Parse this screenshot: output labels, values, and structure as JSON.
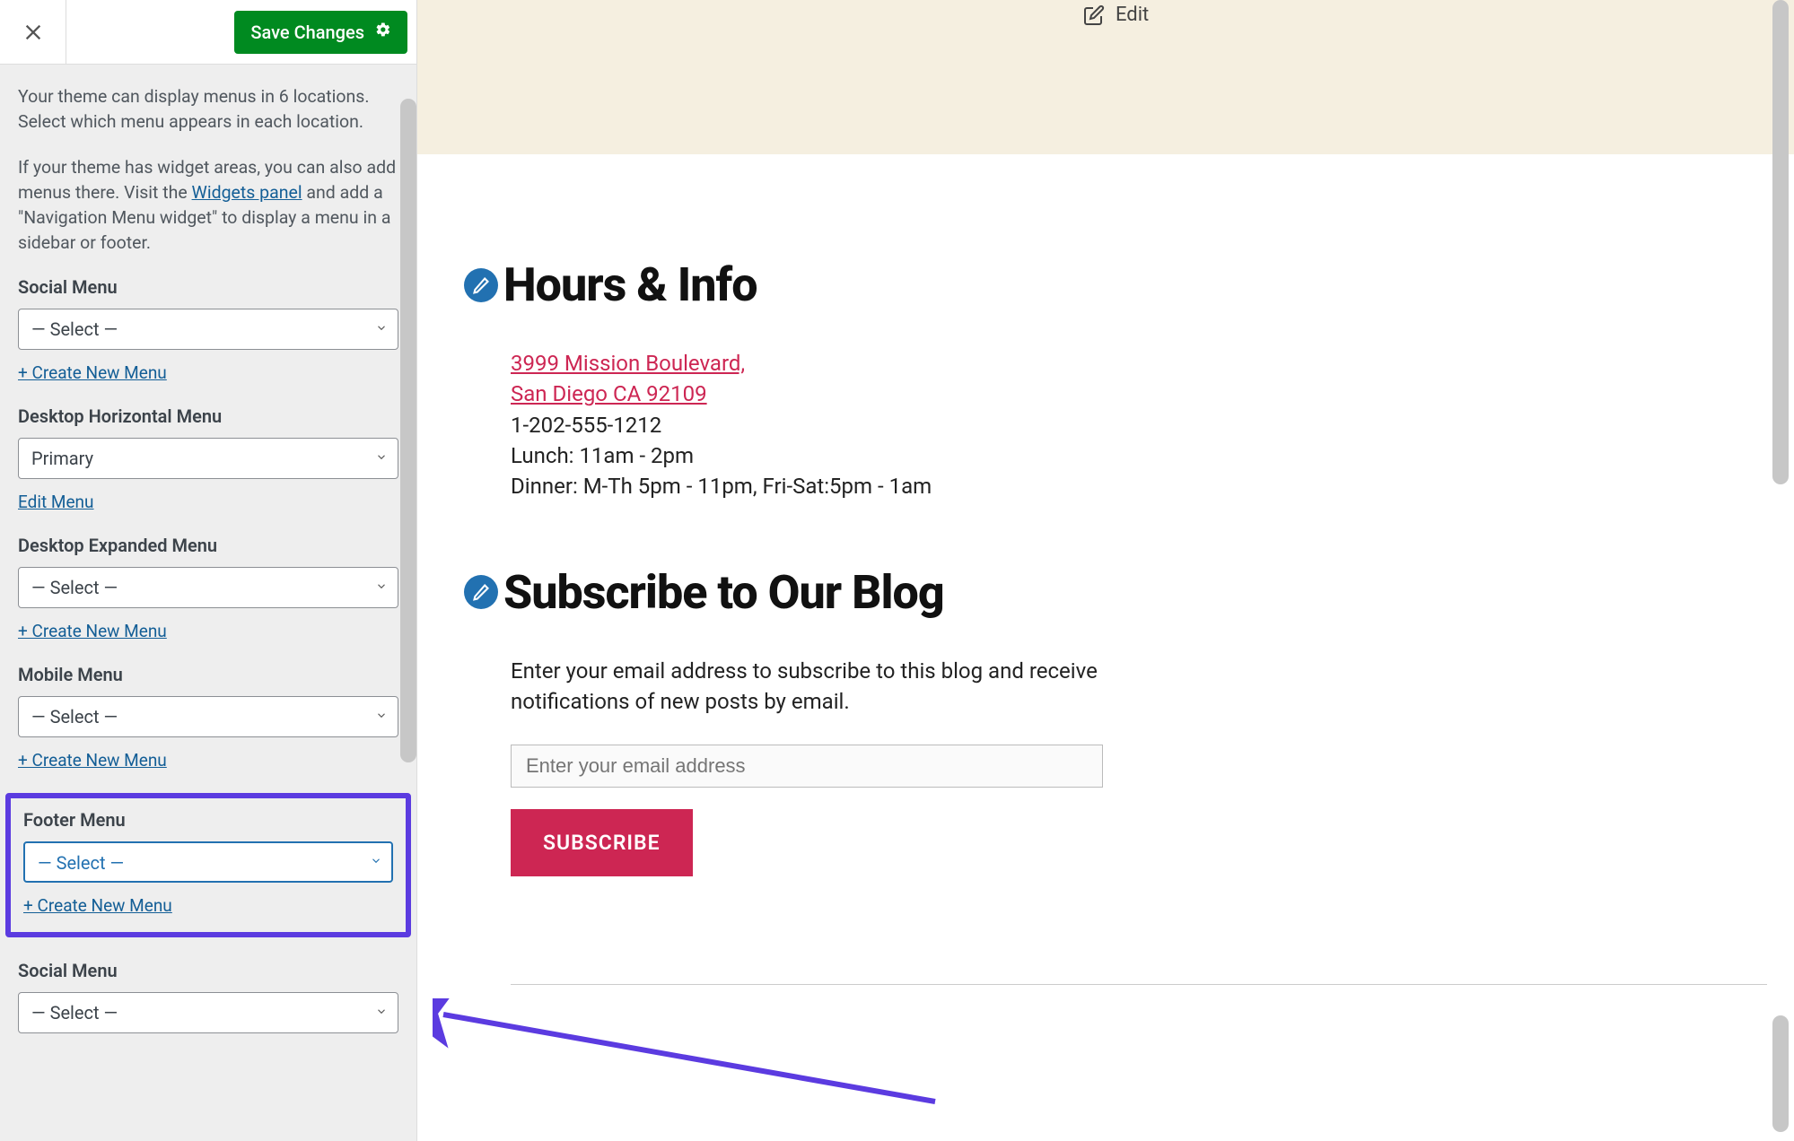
{
  "header": {
    "save_label": "Save Changes"
  },
  "descriptions": {
    "intro": "Your theme can display menus in 6 locations. Select which menu appears in each location.",
    "widget_pre": "If your theme has widget areas, you can also add menus there. Visit the ",
    "widget_link": "Widgets panel",
    "widget_post": " and add a \"Navigation Menu widget\" to display a menu in a sidebar or footer."
  },
  "menus": {
    "social1": {
      "label": "Social Menu",
      "selected": "— Select —",
      "action": "+ Create New Menu"
    },
    "desktop_h": {
      "label": "Desktop Horizontal Menu",
      "selected": "Primary",
      "action": "Edit Menu"
    },
    "desktop_e": {
      "label": "Desktop Expanded Menu",
      "selected": "— Select —",
      "action": "+ Create New Menu"
    },
    "mobile": {
      "label": "Mobile Menu",
      "selected": "— Select —",
      "action": "+ Create New Menu"
    },
    "footer": {
      "label": "Footer Menu",
      "selected": "— Select —",
      "action": "+ Create New Menu"
    },
    "social2": {
      "label": "Social Menu",
      "selected": "— Select —"
    }
  },
  "preview": {
    "edit_label": "Edit",
    "hours_heading": "Hours & Info",
    "address_line1": "3999 Mission Boulevard,",
    "address_line2": "San Diego CA 92109",
    "phone": "1-202-555-1212",
    "lunch": "Lunch: 11am - 2pm",
    "dinner": "Dinner: M-Th 5pm - 11pm, Fri-Sat:5pm - 1am",
    "subscribe_heading": "Subscribe to Our Blog",
    "subscribe_desc": "Enter your email address to subscribe to this blog and receive notifications of new posts by email.",
    "email_placeholder": "Enter your email address",
    "subscribe_btn": "SUBSCRIBE"
  }
}
